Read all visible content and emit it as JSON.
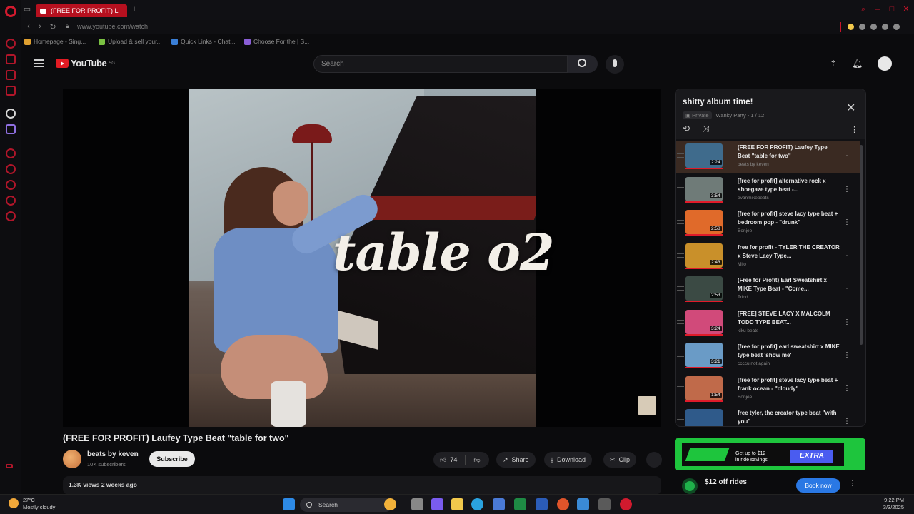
{
  "browser": {
    "tab_title": "(FREE FOR PROFIT) L",
    "url": "www.youtube.com/watch",
    "bookmarks": [
      "Homepage - Sing...",
      "Upload & sell your...",
      "Quick Links - Chat...",
      "Choose For the | S..."
    ]
  },
  "youtube": {
    "logo_text": "YouTube",
    "logo_region": "SG",
    "search_placeholder": "Search"
  },
  "video": {
    "overlay_text": "table o2",
    "title": "(FREE FOR PROFIT) Laufey Type Beat \"table for two\"",
    "channel": "beats by keven",
    "subscribers": "10K subscribers",
    "subscribe_label": "Subscribe",
    "likes": "74",
    "share_label": "Share",
    "download_label": "Download",
    "clip_label": "Clip",
    "description_meta": "1.3K views  2 weeks ago"
  },
  "playlist": {
    "title": "shitty album time!",
    "visibility": "Private",
    "owner_position": "Wanky Party - 1 / 12",
    "items": [
      {
        "title": "(FREE FOR PROFIT) Laufey Type Beat \"table for two\"",
        "channel": "beats by keven",
        "duration": "2:24",
        "thumb": "#3f6b8c"
      },
      {
        "title": "[free for profit] alternative rock x shoegaze type beat -...",
        "channel": "evanmikebeats",
        "duration": "3:54",
        "thumb": "#6f7b78"
      },
      {
        "title": "[free for profit] steve lacy type beat + bedroom pop - \"drunk\"",
        "channel": "Bonjee",
        "duration": "2:58",
        "thumb": "#e06a2a"
      },
      {
        "title": "free for profit - TYLER THE CREATOR x Steve Lacy Type...",
        "channel": "Milo",
        "duration": "2:43",
        "thumb": "#c9902a"
      },
      {
        "title": "(Free for Profit) Earl Sweatshirt x MIKE Type Beat - \"Come...",
        "channel": "Tridd",
        "duration": "2:53",
        "thumb": "#3b4a44"
      },
      {
        "title": "[FREE] STEVE LACY X MALCOLM TODD TYPE BEAT...",
        "channel": "kiku beats",
        "duration": "3:24",
        "thumb": "#d14a7a"
      },
      {
        "title": "[free for profit] earl sweatshirt x MIKE type beat 'show me'",
        "channel": "ccccu not again",
        "duration": "3:21",
        "thumb": "#6a9bc6"
      },
      {
        "title": "[free for profit] steve lacy type beat + frank ocean - \"cloudy\"",
        "channel": "Bonjee",
        "duration": "1:54",
        "thumb": "#c06a4a"
      },
      {
        "title": "free tyler, the creator type beat \"with you\"",
        "channel": "",
        "duration": "",
        "thumb": "#2f5a8a"
      }
    ]
  },
  "ads": {
    "promo_line1": "Get up to $12",
    "promo_line2": "in ride savings",
    "promo_brand": "EXTRA",
    "sponsored_title": "$12 off rides",
    "sponsored_button": "Book now"
  },
  "taskbar": {
    "temp": "27°C",
    "weather": "Mostly cloudy",
    "search_label": "Search",
    "time": "9:22 PM",
    "date": "3/3/2025"
  }
}
